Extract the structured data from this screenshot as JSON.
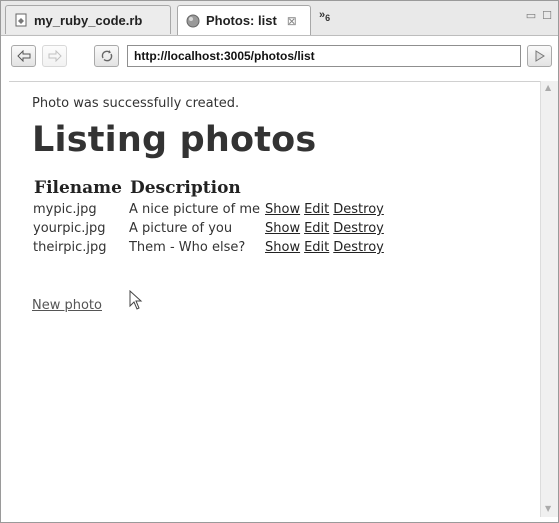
{
  "tabs": [
    {
      "label": "my_ruby_code.rb",
      "icon": "ruby-file-icon"
    },
    {
      "label": "Photos: list",
      "icon": "globe-icon",
      "close": "⊠"
    }
  ],
  "overflow": {
    "symbol": "»",
    "count": "6"
  },
  "toolbar": {
    "url": "http://localhost:3005/photos/list"
  },
  "page": {
    "notice": "Photo was successfully created.",
    "title": "Listing photos",
    "columns": [
      "Filename",
      "Description"
    ],
    "rows": [
      {
        "filename": "mypic.jpg",
        "description": "A nice picture of me",
        "actions": [
          "Show",
          "Edit",
          "Destroy"
        ]
      },
      {
        "filename": "yourpic.jpg",
        "description": "A picture of you",
        "actions": [
          "Show",
          "Edit",
          "Destroy"
        ]
      },
      {
        "filename": "theirpic.jpg",
        "description": "Them - Who else?",
        "actions": [
          "Show",
          "Edit",
          "Destroy"
        ]
      }
    ],
    "new_link": "New photo"
  }
}
